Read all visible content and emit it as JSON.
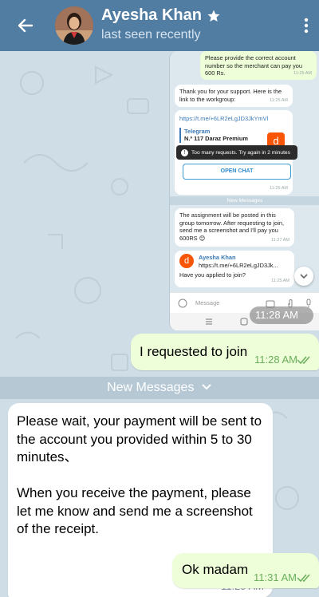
{
  "header": {
    "title": "Ayesha Khan",
    "status": "last seen recently"
  },
  "embedded_screenshot": {
    "msg_correct_account": "Please provide the correct account number so the merchant can pay you 600 Rs.",
    "msg_correct_account_time": "11:25 AM",
    "msg_thanks": "Thank you for your support. Here is the link to the workgroup:",
    "msg_thanks_time": "11:25 AM",
    "link": "https://t.me/+6LR2eLgJD3JkYmVl",
    "preview_site": "Telegram",
    "preview_title": "N.º 117 Daraz Premium",
    "toast": "Too many requests. Try again in 2 minutes",
    "open_chat": "OPEN CHAT",
    "preview_time": "11:25 AM",
    "new_messages": "New Messages",
    "msg_assignment": "The assignment will be posted in this group tomorrow. After requesting to join, send me a screenshot and I'll pay you 600RS 😊",
    "msg_assignment_time": "11:27 AM",
    "reply_name": "Ayesha Khan",
    "reply_quote": "https://t.me/+6LR2eLgJD3Jk...",
    "msg_applied": "Have you applied to join?",
    "msg_applied_time": "11:25 AM",
    "input_placeholder": "Message",
    "time_overlay": "11:28 AM"
  },
  "messages": {
    "m1_text": "I requested to join",
    "m1_time": "11:28 AM",
    "m2_text": "Please wait, your payment will be sent to the account you provided within 5 to 30 minutes、\n\nWhen you receive the payment, please let me know and send me a screenshot of the receipt.",
    "m2_time": "11:29 AM",
    "m3_text": "Ok madam",
    "m3_time": "11:31 AM"
  },
  "new_messages_label": "New Messages",
  "colors": {
    "header": "#517da2",
    "outgoing_bubble": "#eefed8",
    "chat_background": "#cfdde6",
    "read_check": "#6aae5b"
  }
}
